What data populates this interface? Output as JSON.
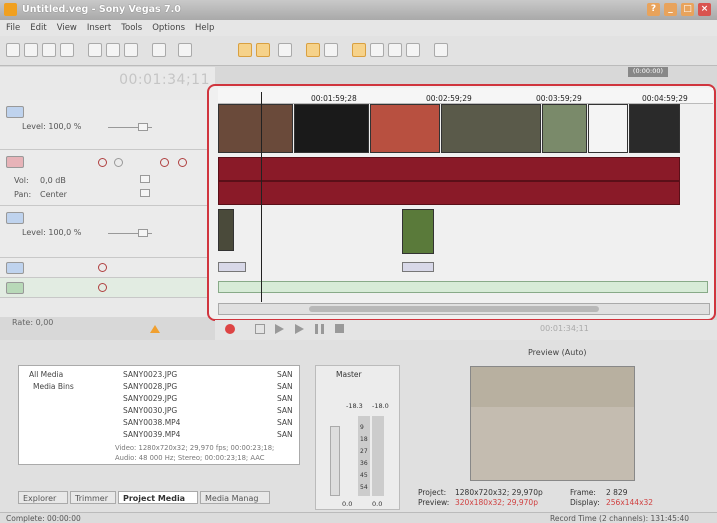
{
  "window": {
    "title": "Untitled.veg - Sony Vegas 7.0"
  },
  "menu": [
    "File",
    "Edit",
    "View",
    "Insert",
    "Tools",
    "Options",
    "Help"
  ],
  "timecode": "00:01:34;11",
  "tracks": {
    "video1": {
      "level": "Level: 100,0 %"
    },
    "audio1": {
      "vol_label": "Vol:",
      "vol_value": "0,0 dB",
      "pan_label": "Pan:",
      "pan_value": "Center"
    },
    "video2": {
      "level": "Level: 100,0 %"
    }
  },
  "ruler": [
    "00:01:59;28",
    "00:02:59;29",
    "00:03:59;29",
    "00:04:59;29"
  ],
  "ruler_badge": "(0:00:00)",
  "rate": "Rate: 0,00",
  "transport_timecode": "00:01:34;11",
  "explorer": {
    "folders": [
      "All Media",
      "Media Bins"
    ],
    "files": [
      "SANY0023.JPG",
      "SANY0028.JPG",
      "SANY0029.JPG",
      "SANY0030.JPG",
      "SANY0038.MP4",
      "SANY0039.MP4"
    ],
    "right_files": [
      "SAN",
      "SAN",
      "SAN",
      "SAN",
      "SAN",
      "SAN"
    ],
    "video_info": "Video: 1280x720x32; 29,970 fps; 00:00:23;18;",
    "audio_info": "Audio: 48 000 Hz; Stereo; 00:00:23;18; AAC"
  },
  "tabs": [
    "Explorer",
    "Trimmer",
    "Project Media",
    "Media Manag"
  ],
  "mixer": {
    "label": "Master",
    "scale_left": "-18.3",
    "scale_right": "-18.0",
    "meter": [
      "9",
      "18",
      "27",
      "36",
      "45",
      "54"
    ],
    "bottom_left": "0.0",
    "bottom_right": "0.0"
  },
  "preview": {
    "mode": "Preview (Auto)",
    "project_label": "Project:",
    "project_value": "1280x720x32; 29,970p",
    "preview_label": "Preview:",
    "preview_value": "320x180x32; 29,970p",
    "frame_label": "Frame:",
    "frame_value": "2 829",
    "display_label": "Display:",
    "display_value": "256x144x32"
  },
  "status": {
    "left": "Complete: 00:00:00",
    "right": "Record Time (2 channels): 131:45:40"
  }
}
